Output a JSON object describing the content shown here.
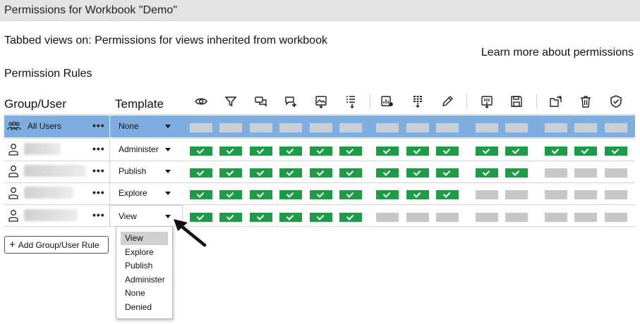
{
  "window": {
    "title": "Permissions for Workbook \"Demo\""
  },
  "subtitle": "Tabbed views on: Permissions for views inherited from workbook",
  "learn_more": "Learn more about permissions",
  "rules_label": "Permission Rules",
  "headers": {
    "group_user": "Group/User",
    "template": "Template"
  },
  "capabilities": [
    {
      "icon": "eye-icon"
    },
    {
      "icon": "filter-icon"
    },
    {
      "icon": "comments-icon"
    },
    {
      "icon": "add-comment-icon"
    },
    {
      "icon": "download-image-icon"
    },
    {
      "icon": "download-summary-data-icon"
    },
    {
      "icon": "share-customized-icon"
    },
    {
      "icon": "download-full-data-icon"
    },
    {
      "icon": "web-edit-icon"
    },
    {
      "icon": "download-workbook-icon"
    },
    {
      "icon": "overwrite-icon"
    },
    {
      "icon": "move-icon"
    },
    {
      "icon": "delete-icon"
    },
    {
      "icon": "set-permissions-icon"
    }
  ],
  "rows": [
    {
      "type": "group",
      "name": "All Users",
      "template": "None",
      "cells": [
        "none",
        "none",
        "none",
        "none",
        "none",
        "none",
        "none",
        "none",
        "none",
        "none",
        "none",
        "none",
        "none",
        "none"
      ]
    },
    {
      "type": "user",
      "name": "",
      "template": "Administer",
      "cells": [
        "allow",
        "allow",
        "allow",
        "allow",
        "allow",
        "allow",
        "allow",
        "allow",
        "allow",
        "allow",
        "allow",
        "allow",
        "allow",
        "allow"
      ]
    },
    {
      "type": "user",
      "name": "",
      "template": "Publish",
      "cells": [
        "allow",
        "allow",
        "allow",
        "allow",
        "allow",
        "allow",
        "allow",
        "allow",
        "allow",
        "allow",
        "allow",
        "none",
        "none",
        "none"
      ]
    },
    {
      "type": "user",
      "name": "",
      "template": "Explore",
      "cells": [
        "allow",
        "allow",
        "allow",
        "allow",
        "allow",
        "allow",
        "allow",
        "allow",
        "allow",
        "none",
        "none",
        "none",
        "none",
        "none"
      ]
    },
    {
      "type": "user",
      "name": "",
      "template": "View",
      "cells": [
        "allow",
        "allow",
        "allow",
        "allow",
        "allow",
        "allow",
        "none",
        "none",
        "none",
        "none",
        "none",
        "none",
        "none",
        "none"
      ]
    }
  ],
  "more_actions_glyph": "•••",
  "add_button": {
    "plus": "+",
    "label": "Add Group/User Rule"
  },
  "dropdown": {
    "options": [
      "View",
      "Explore",
      "Publish",
      "Administer",
      "None",
      "Denied"
    ],
    "selected": "View"
  },
  "colors": {
    "allowed": "#1e9b47",
    "unspecified": "#c7c7c7",
    "selected_row": "#7eaee0"
  }
}
